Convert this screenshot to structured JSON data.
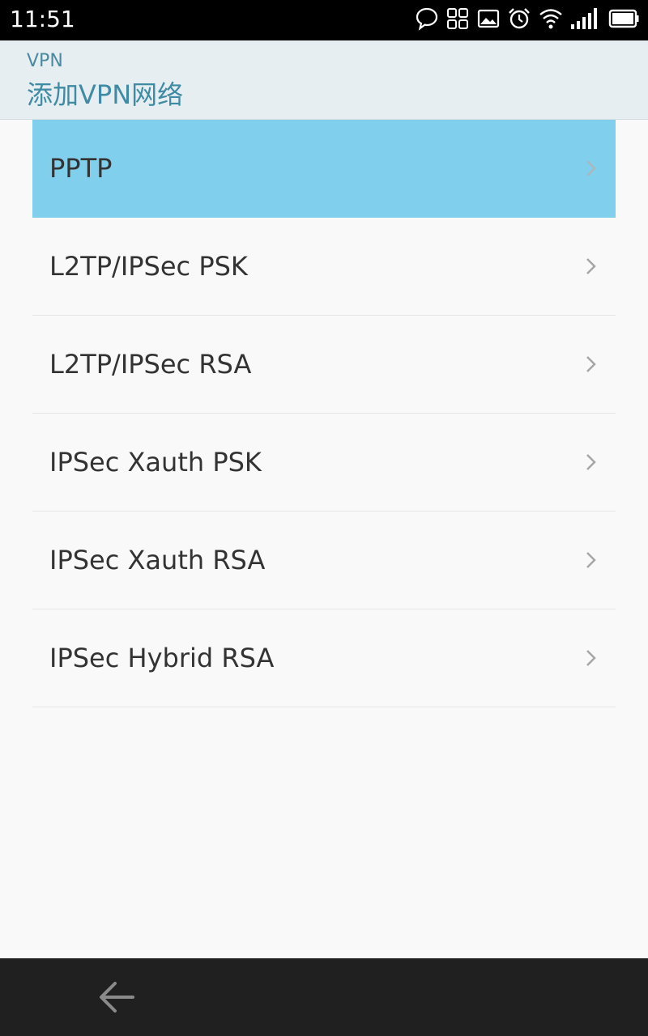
{
  "status_bar": {
    "time": "11:51",
    "icons": [
      "chat-bubble-icon",
      "apps-grid-icon",
      "image-icon",
      "alarm-icon",
      "wifi-icon",
      "signal-icon",
      "battery-icon"
    ]
  },
  "header": {
    "subtitle": "VPN",
    "title": "添加VPN网络"
  },
  "vpn_types": [
    {
      "label": "PPTP",
      "selected": true
    },
    {
      "label": "L2TP/IPSec PSK",
      "selected": false
    },
    {
      "label": "L2TP/IPSec RSA",
      "selected": false
    },
    {
      "label": "IPSec Xauth PSK",
      "selected": false
    },
    {
      "label": "IPSec Xauth RSA",
      "selected": false
    },
    {
      "label": "IPSec Hybrid RSA",
      "selected": false
    }
  ],
  "colors": {
    "selected_background": "#7fcfed",
    "header_background": "#e7eef1",
    "header_text": "#3f8ba4",
    "nav_bar": "#202020"
  },
  "nav_bar": {
    "icons": [
      "back-arrow-icon"
    ]
  }
}
